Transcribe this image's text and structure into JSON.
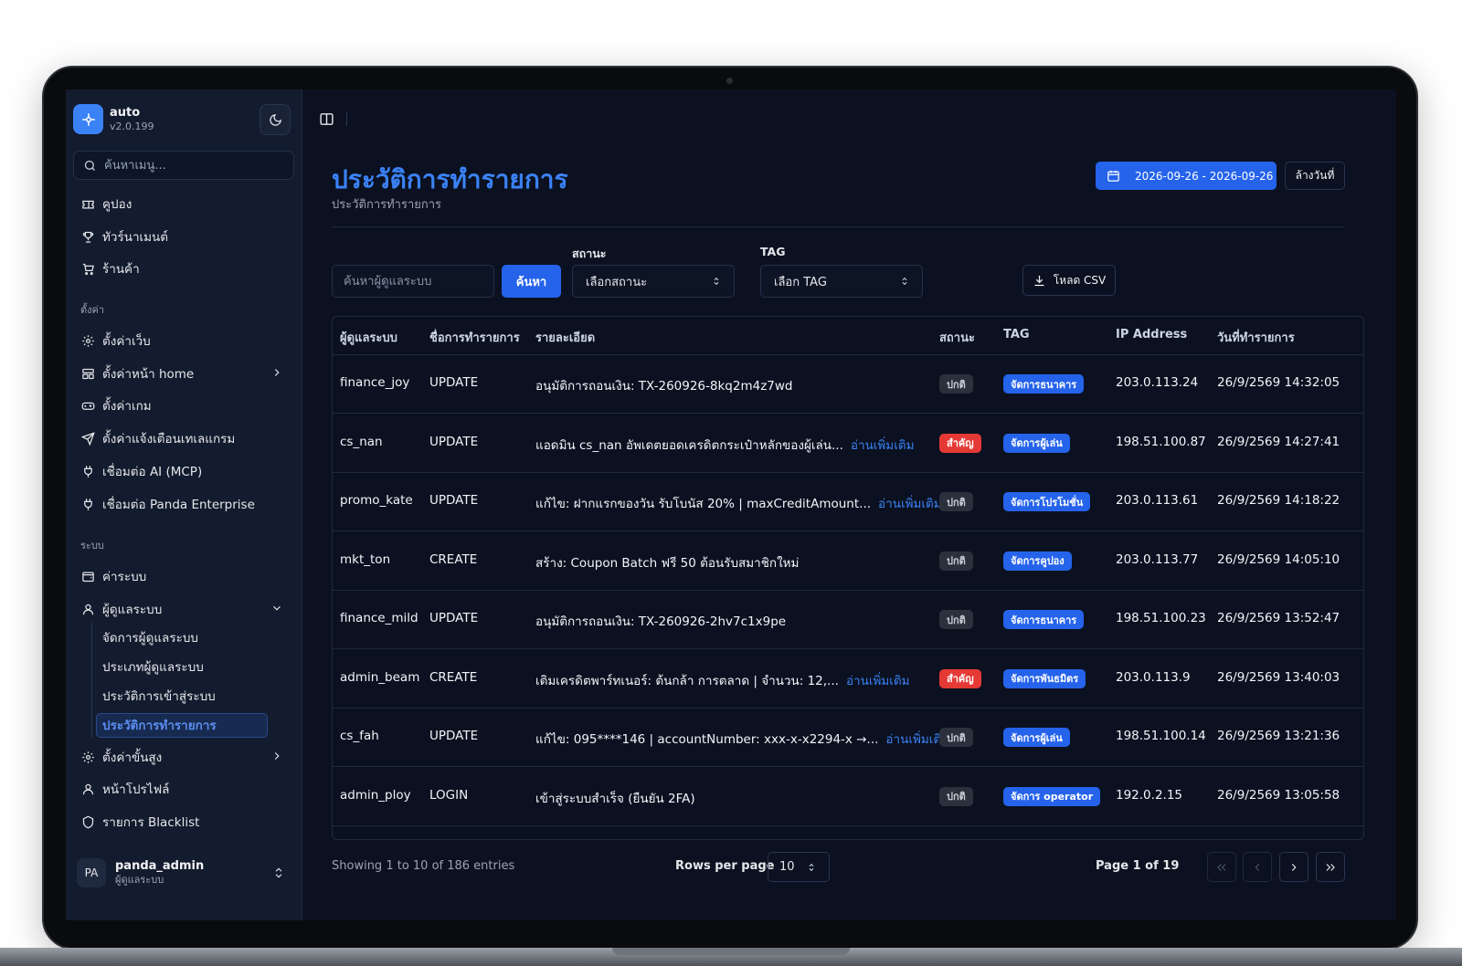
{
  "app": {
    "name": "auto",
    "version": "v2.0.199"
  },
  "sidebar": {
    "search_placeholder": "ค้นหาเมนู...",
    "top_items": [
      {
        "label": "คูปอง",
        "icon": "ticket-icon"
      },
      {
        "label": "ทัวร์นาเมนต์",
        "icon": "trophy-icon"
      },
      {
        "label": "ร้านค้า",
        "icon": "cart-icon"
      }
    ],
    "settings_label": "ตั้งค่า",
    "settings_items": [
      {
        "label": "ตั้งค่าเว็บ",
        "icon": "gear-icon"
      },
      {
        "label": "ตั้งค่าหน้า home",
        "icon": "layout-icon"
      },
      {
        "label": "ตั้งค่าเกม",
        "icon": "gamepad-icon"
      },
      {
        "label": "ตั้งค่าแจ้งเตือนเทเลแกรม",
        "icon": "send-icon"
      },
      {
        "label": "เชื่อมต่อ AI (MCP)",
        "icon": "plug-icon"
      },
      {
        "label": "เชื่อมต่อ Panda Enterprise",
        "icon": "plug-icon"
      }
    ],
    "system_label": "ระบบ",
    "system_items": [
      {
        "label": "ค่าระบบ",
        "icon": "wallet-icon"
      },
      {
        "label": "ผู้ดูแลระบบ",
        "icon": "user-icon"
      }
    ],
    "admin_sub_items": [
      "จัดการผู้ดูแลระบบ",
      "ประเภทผู้ดูแลระบบ",
      "ประวัติการเข้าสู่ระบบ",
      "ประวัติการทำรายการ"
    ],
    "bottom_items": [
      {
        "label": "ตั้งค่าขั้นสูง",
        "icon": "gear-icon"
      },
      {
        "label": "หน้าโปรไฟล์",
        "icon": "user-icon"
      },
      {
        "label": "รายการ Blacklist",
        "icon": "shield-icon"
      }
    ],
    "user": {
      "initials": "PA",
      "name": "panda_admin",
      "role": "ผู้ดูแลระบบ"
    }
  },
  "header": {
    "title": "ประวัติการทำรายการ",
    "subtitle": "ประวัติการทำรายการ",
    "date_range": "2026-09-26 - 2026-09-26",
    "clear_date": "ล้างวันที่"
  },
  "filters": {
    "user_search_placeholder": "ค้นหาผู้ดูแลระบบ",
    "search_button": "ค้นหา",
    "status_label": "สถานะ",
    "status_value": "เลือกสถานะ",
    "tag_label": "TAG",
    "tag_value": "เลือก TAG",
    "csv_button": "โหลด CSV"
  },
  "table": {
    "columns": [
      "ผู้ดูแลระบบ",
      "ชื่อการทำรายการ",
      "รายละเอียด",
      "สถานะ",
      "TAG",
      "IP Address",
      "วันที่ทำรายการ"
    ],
    "read_more": "อ่านเพิ่มเติม",
    "rows": [
      {
        "admin": "finance_joy",
        "action": "UPDATE",
        "detail": "อนุมัติการถอนเงิน: TX-260926-8kq2m4z7wd",
        "more": false,
        "status": "ปกติ",
        "status_type": "normal",
        "tag": "จัดการธนาคาร",
        "ip": "203.0.113.24",
        "date": "26/9/2569 14:32:05"
      },
      {
        "admin": "cs_nan",
        "action": "UPDATE",
        "detail": "แอดมิน cs_nan อัพเดตยอดเครดิตกระเป๋าหลักของผู้เล่น...",
        "more": true,
        "status": "สำคัญ",
        "status_type": "important",
        "tag": "จัดการผู้เล่น",
        "ip": "198.51.100.87",
        "date": "26/9/2569 14:27:41"
      },
      {
        "admin": "promo_kate",
        "action": "UPDATE",
        "detail": "แก้ไข: ฝากแรกของวัน รับโบนัส 20% | maxCreditAmount...",
        "more": true,
        "status": "ปกติ",
        "status_type": "normal",
        "tag": "จัดการโปรโมชั่น",
        "ip": "203.0.113.61",
        "date": "26/9/2569 14:18:22"
      },
      {
        "admin": "mkt_ton",
        "action": "CREATE",
        "detail": "สร้าง: Coupon Batch ฟรี 50 ต้อนรับสมาชิกใหม่",
        "more": false,
        "status": "ปกติ",
        "status_type": "normal",
        "tag": "จัดการคูปอง",
        "ip": "203.0.113.77",
        "date": "26/9/2569 14:05:10"
      },
      {
        "admin": "finance_mild",
        "action": "UPDATE",
        "detail": "อนุมัติการถอนเงิน: TX-260926-2hv7c1x9pe",
        "more": false,
        "status": "ปกติ",
        "status_type": "normal",
        "tag": "จัดการธนาคาร",
        "ip": "198.51.100.23",
        "date": "26/9/2569 13:52:47"
      },
      {
        "admin": "admin_beam",
        "action": "CREATE",
        "detail": "เติมเครดิตพาร์ทเนอร์: ต้นกล้า การตลาด | จำนวน: 12,...",
        "more": true,
        "status": "สำคัญ",
        "status_type": "important",
        "tag": "จัดการพันธมิตร",
        "ip": "203.0.113.9",
        "date": "26/9/2569 13:40:03"
      },
      {
        "admin": "cs_fah",
        "action": "UPDATE",
        "detail": "แก้ไข: 095****146 | accountNumber: xxx-x-x2294-x →...",
        "more": true,
        "status": "ปกติ",
        "status_type": "normal",
        "tag": "จัดการผู้เล่น",
        "ip": "198.51.100.14",
        "date": "26/9/2569 13:21:36"
      },
      {
        "admin": "admin_ploy",
        "action": "LOGIN",
        "detail": "เข้าสู่ระบบสำเร็จ (ยืนยัน 2FA)",
        "more": false,
        "status": "ปกติ",
        "status_type": "normal",
        "tag": "จัดการ operator",
        "ip": "192.0.2.15",
        "date": "26/9/2569 13:05:58"
      }
    ]
  },
  "footer": {
    "showing": "Showing 1 to 10 of 186 entries",
    "rows_per_page_label": "Rows per page",
    "rows_per_page_value": "10",
    "page_info": "Page 1 of 19"
  },
  "colors": {
    "accent": "#3b82f6",
    "important": "#e53935",
    "background": "#0b1120",
    "sidebar": "#131b2e"
  }
}
